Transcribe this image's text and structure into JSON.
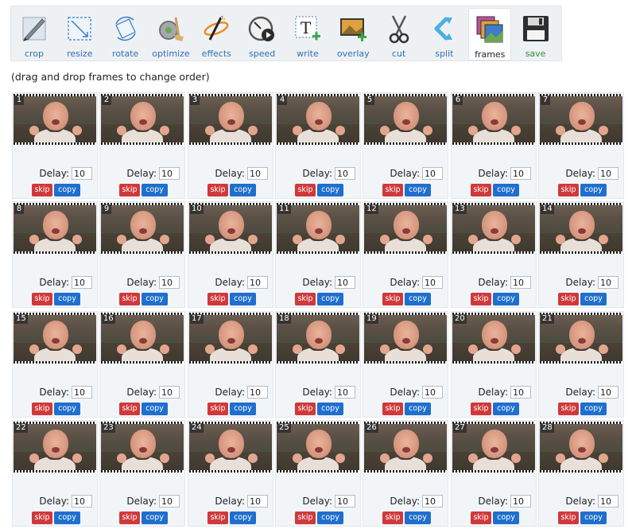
{
  "toolbar": {
    "tools": [
      {
        "label": "crop",
        "icon": "crop-icon"
      },
      {
        "label": "resize",
        "icon": "resize-icon"
      },
      {
        "label": "rotate",
        "icon": "rotate-icon"
      },
      {
        "label": "optimize",
        "icon": "optimize-icon"
      },
      {
        "label": "effects",
        "icon": "effects-icon"
      },
      {
        "label": "speed",
        "icon": "speed-icon"
      },
      {
        "label": "write",
        "icon": "write-icon"
      },
      {
        "label": "overlay",
        "icon": "overlay-icon"
      },
      {
        "label": "cut",
        "icon": "scissors-icon"
      },
      {
        "label": "split",
        "icon": "split-icon"
      },
      {
        "label": "frames",
        "icon": "frames-icon"
      },
      {
        "label": "save",
        "icon": "floppy-disk-icon"
      }
    ],
    "active": "frames"
  },
  "hint": "(drag and drop frames to change order)",
  "frame_ui": {
    "delay_label": "Delay:",
    "skip_label": "skip",
    "copy_label": "copy"
  },
  "frames": [
    {
      "n": "1",
      "delay": "10"
    },
    {
      "n": "2",
      "delay": "10"
    },
    {
      "n": "3",
      "delay": "10"
    },
    {
      "n": "4",
      "delay": "10"
    },
    {
      "n": "5",
      "delay": "10"
    },
    {
      "n": "6",
      "delay": "10"
    },
    {
      "n": "7",
      "delay": "10"
    },
    {
      "n": "8",
      "delay": "10"
    },
    {
      "n": "9",
      "delay": "10"
    },
    {
      "n": "10",
      "delay": "10"
    },
    {
      "n": "11",
      "delay": "10"
    },
    {
      "n": "12",
      "delay": "10"
    },
    {
      "n": "13",
      "delay": "10"
    },
    {
      "n": "14",
      "delay": "10"
    },
    {
      "n": "15",
      "delay": "10"
    },
    {
      "n": "16",
      "delay": "10"
    },
    {
      "n": "17",
      "delay": "10"
    },
    {
      "n": "18",
      "delay": "10"
    },
    {
      "n": "19",
      "delay": "10"
    },
    {
      "n": "20",
      "delay": "10"
    },
    {
      "n": "21",
      "delay": "10"
    },
    {
      "n": "22",
      "delay": "10"
    },
    {
      "n": "23",
      "delay": "10"
    },
    {
      "n": "24",
      "delay": "10"
    },
    {
      "n": "25",
      "delay": "10"
    },
    {
      "n": "26",
      "delay": "10"
    },
    {
      "n": "27",
      "delay": "10"
    },
    {
      "n": "28",
      "delay": "10"
    }
  ],
  "colors": {
    "skip": "#d0393b",
    "copy": "#1f6fce",
    "tool_label": "#2f6fb5",
    "save_label": "#2f8f3a"
  }
}
